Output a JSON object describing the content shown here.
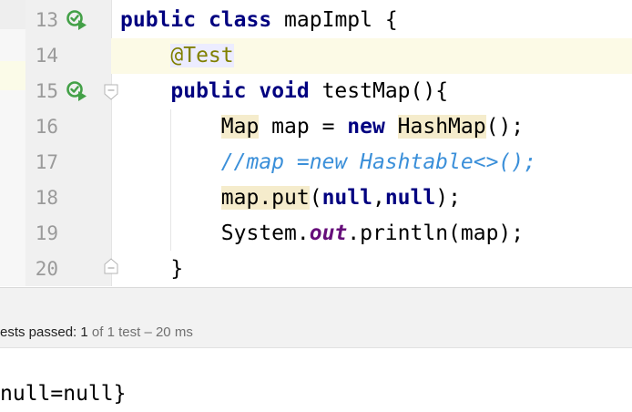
{
  "editor": {
    "lines": [
      {
        "num": "13",
        "tokens": [
          [
            "kw",
            "public"
          ],
          [
            "t",
            " "
          ],
          [
            "kw",
            "class"
          ],
          [
            "t",
            " mapImpl {"
          ]
        ]
      },
      {
        "num": "14",
        "tokens": [
          [
            "t",
            "    "
          ],
          [
            "ann",
            "@Test"
          ]
        ]
      },
      {
        "num": "15",
        "tokens": [
          [
            "t",
            "    "
          ],
          [
            "kw",
            "public"
          ],
          [
            "t",
            " "
          ],
          [
            "kw",
            "void"
          ],
          [
            "t",
            " testMap(){"
          ]
        ]
      },
      {
        "num": "16",
        "tokens": [
          [
            "t",
            "        "
          ],
          [
            "hl",
            "Map"
          ],
          [
            "t",
            " map = "
          ],
          [
            "kw",
            "new"
          ],
          [
            "t",
            " "
          ],
          [
            "hl",
            "HashMap"
          ],
          [
            "t",
            "();"
          ]
        ]
      },
      {
        "num": "17",
        "tokens": [
          [
            "t",
            "        "
          ],
          [
            "cmt",
            "//map =new Hashtable<>();"
          ]
        ]
      },
      {
        "num": "18",
        "tokens": [
          [
            "t",
            "        "
          ],
          [
            "hl",
            "map.put"
          ],
          [
            "t",
            "("
          ],
          [
            "kw",
            "null"
          ],
          [
            "t",
            ","
          ],
          [
            "kw",
            "null"
          ],
          [
            "t",
            ");"
          ]
        ]
      },
      {
        "num": "19",
        "tokens": [
          [
            "t",
            "        System."
          ],
          [
            "field",
            "out"
          ],
          [
            "t",
            ".println(map);"
          ]
        ]
      },
      {
        "num": "20",
        "tokens": [
          [
            "t",
            "    }"
          ]
        ]
      }
    ]
  },
  "status": {
    "label": "ests passed:",
    "passed": "1",
    "of_text": "of 1 test",
    "sep": "–",
    "duration": "20 ms"
  },
  "console": {
    "output": "null=null}"
  },
  "colors": {
    "run_icon": "#43a047",
    "keyword": "#000080",
    "comment": "#3a8fd9"
  }
}
